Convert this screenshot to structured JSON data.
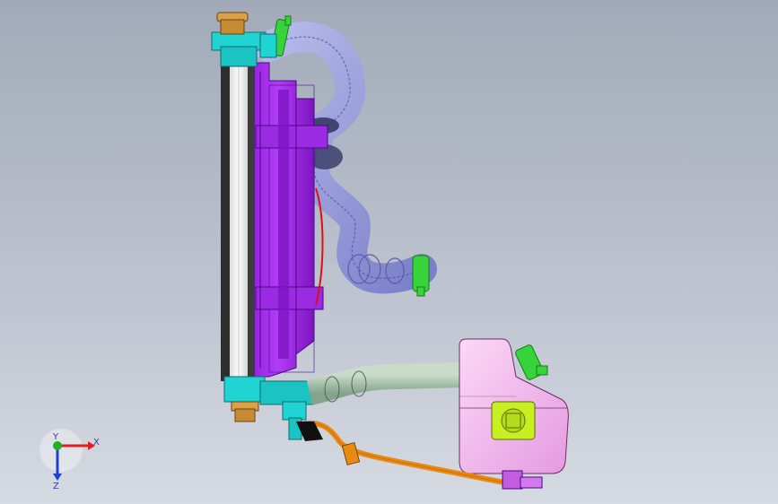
{
  "scene": {
    "background_top": "#a2aab9",
    "background_bottom": "#d6dae2",
    "colors": {
      "radiator_core": "#ffffff",
      "radiator_tank": "#2e2e2e",
      "fan_shroud": "#a020f0",
      "fan_shroud_dark": "#6a12b0",
      "upper_hose": "#8b8fd6",
      "lower_hose": "#9fb8a4",
      "overflow_tank": "#f2b9ee",
      "overflow_cap": "#c8f020",
      "overflow_line": "#e88a12",
      "hose_clamp": "#37d33a",
      "fittings": "#21d4d4",
      "cap_brass": "#d9a24a",
      "seal_black": "#111111"
    }
  },
  "triad": {
    "x_label": "X",
    "y_label": "Y",
    "z_label": "Z",
    "x_color": "#e02020",
    "y_color": "#20b020",
    "z_color": "#2040d0"
  }
}
